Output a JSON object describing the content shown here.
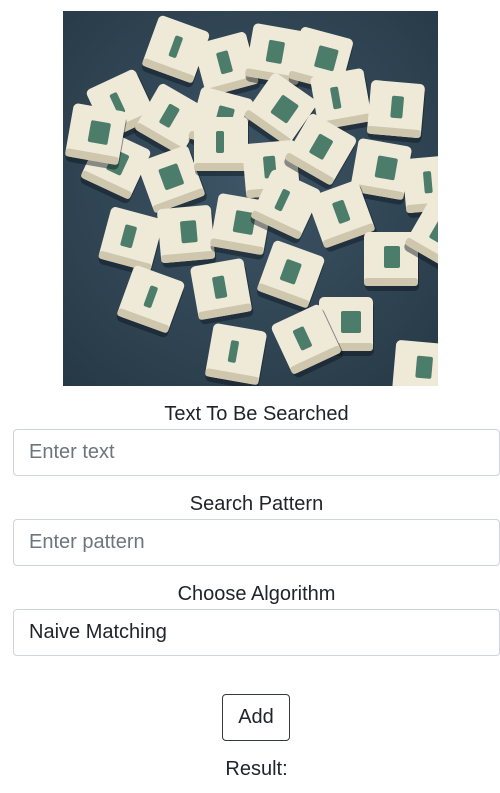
{
  "form": {
    "text_label": "Text To Be Searched",
    "text_placeholder": "Enter text",
    "pattern_label": "Search Pattern",
    "pattern_placeholder": "Enter pattern",
    "algorithm_label": "Choose Algorithm",
    "algorithm_selected": "Naive Matching",
    "add_button": "Add",
    "result_label": "Result:"
  },
  "hero_image": {
    "icon": "scrabble-tiles-photo",
    "background_color": "#2f4454",
    "tile_color": "#efe9d8",
    "letter_color": "#2e6a57"
  }
}
